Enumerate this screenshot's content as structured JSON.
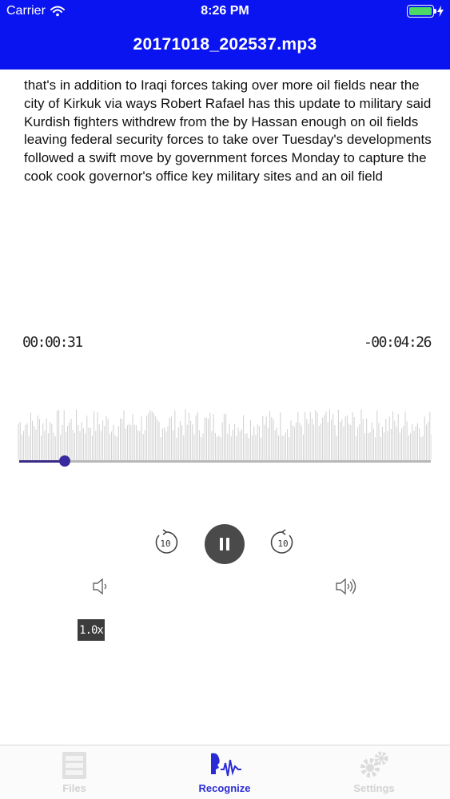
{
  "status_bar": {
    "carrier": "Carrier",
    "time": "8:26 PM",
    "battery_icon": "battery-full-icon",
    "wifi_icon": "wifi-icon"
  },
  "nav": {
    "title": "20171018_202537.mp3"
  },
  "transcript": {
    "text": "that's in addition to Iraqi forces taking over more oil fields near the city of Kirkuk via ways Robert Rafael has this update to military said Kurdish fighters withdrew from the by Hassan enough on oil fields leaving federal security forces to take over Tuesday's developments followed a swift move by government forces Monday to capture the cook cook governor's office key military sites and an oil field"
  },
  "player": {
    "elapsed": "00:00:31",
    "remaining": "-00:04:26",
    "progress_fraction": 0.11,
    "rewind_label": "10",
    "forward_label": "10",
    "speed": "1.0x",
    "state": "playing"
  },
  "tabs": [
    {
      "label": "Files",
      "icon": "files-icon",
      "active": false
    },
    {
      "label": "Recognize",
      "icon": "recognize-icon",
      "active": true
    },
    {
      "label": "Settings",
      "icon": "gear-icon",
      "active": false
    }
  ],
  "colors": {
    "header_bg": "#0a14f0",
    "accent": "#2b2bd6",
    "progress_knob": "#3a2aa0",
    "battery": "#4cd964"
  }
}
